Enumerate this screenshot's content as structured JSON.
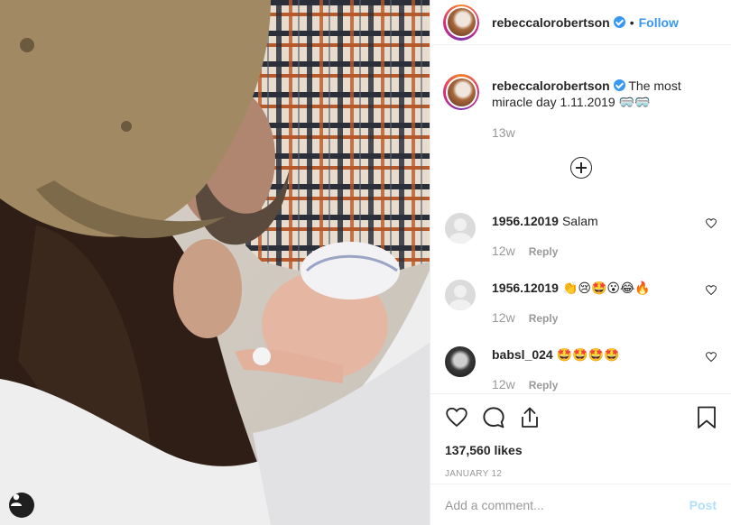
{
  "header": {
    "username": "rebeccalorobertson",
    "separator": "•",
    "follow_label": "Follow"
  },
  "caption": {
    "username": "rebeccalorobertson",
    "text": "The most miracle day 1.11.2019 🥽🥽",
    "time": "13w"
  },
  "comments": [
    {
      "username": "1956.12019",
      "text": "Salam",
      "time": "12w",
      "reply_label": "Reply",
      "avatar": "default-avatar"
    },
    {
      "username": "1956.12019",
      "text": "👏😢🤩😮😂🔥",
      "time": "12w",
      "reply_label": "Reply",
      "avatar": "default-avatar"
    },
    {
      "username": "babsl_024",
      "text": "🤩🤩🤩🤩",
      "time": "12w",
      "reply_label": "Reply",
      "avatar": "user-photo"
    }
  ],
  "actions": {
    "likes": "137,560 likes",
    "date": "JANUARY 12"
  },
  "add_comment": {
    "placeholder": "Add a comment...",
    "post_label": "Post"
  },
  "colors": {
    "link_blue": "#3897f0",
    "post_disabled": "#b2dffc",
    "muted": "#999999",
    "text": "#262626"
  }
}
